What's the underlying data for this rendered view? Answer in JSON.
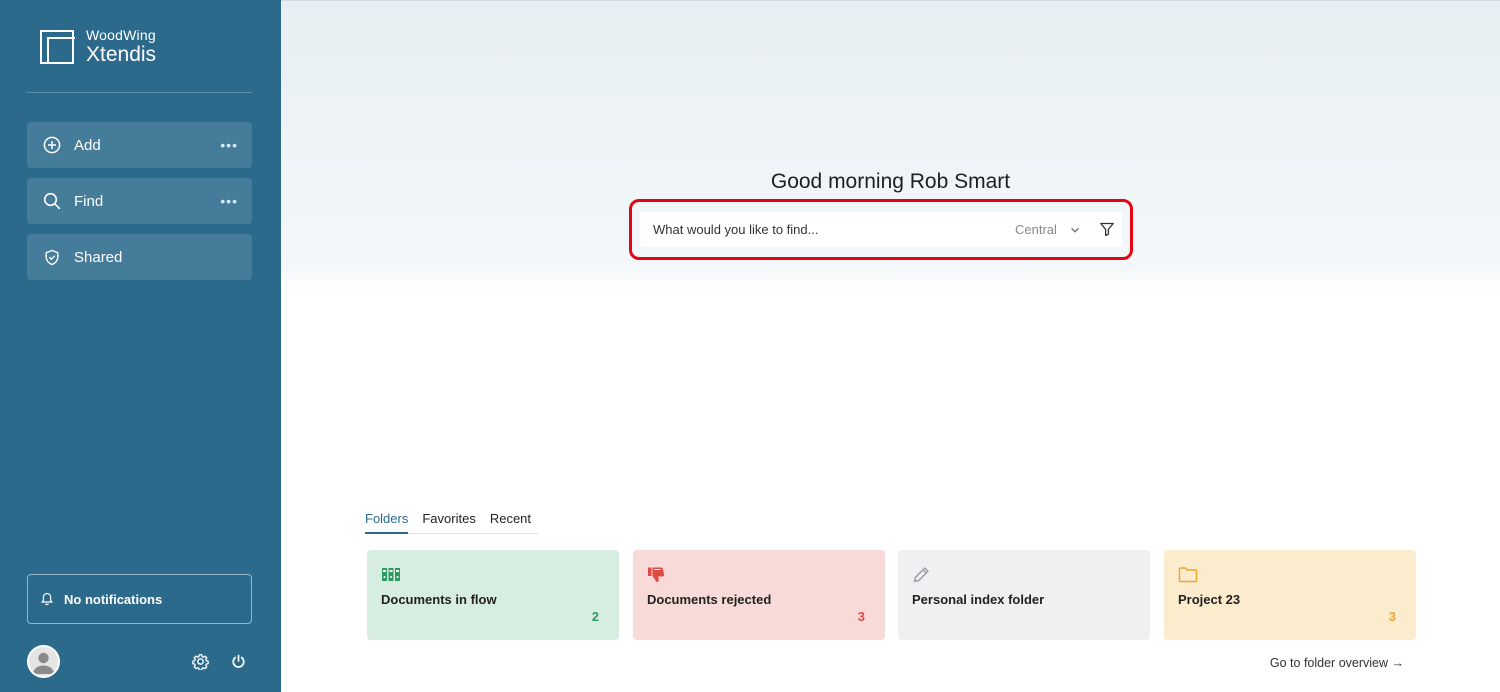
{
  "brand": {
    "line1": "WoodWing",
    "line2": "Xtendis"
  },
  "sidebar": {
    "items": [
      {
        "label": "Add",
        "icon": "plus-circle-icon",
        "more": "•••"
      },
      {
        "label": "Find",
        "icon": "search-icon",
        "more": "•••"
      },
      {
        "label": "Shared",
        "icon": "shield-icon"
      }
    ],
    "notifications": "No notifications"
  },
  "main": {
    "greeting": "Good morning Rob Smart",
    "search": {
      "placeholder": "What would you like to find...",
      "scope": "Central"
    },
    "tabs": [
      "Folders",
      "Favorites",
      "Recent"
    ],
    "active_tab": "Folders",
    "cards": [
      {
        "title": "Documents in flow",
        "count": "2",
        "icon": "binders-icon",
        "bg": "#d7ede1",
        "accent": "#2e9b62"
      },
      {
        "title": "Documents rejected",
        "count": "3",
        "icon": "thumbs-down-icon",
        "bg": "#f8dad9",
        "accent": "#e04a44"
      },
      {
        "title": "Personal index folder",
        "count": "",
        "icon": "pencil-icon",
        "bg": "#eef0f2",
        "accent": "#9aa0a6"
      },
      {
        "title": "Project 23",
        "count": "3",
        "icon": "folder-icon",
        "bg": "#fcecce",
        "accent": "#f0a531"
      }
    ],
    "folder_overview_link": "Go to folder overview →"
  },
  "colors": {
    "sidebar": "#2c6a8c",
    "highlight": "#e20613",
    "accent": "#2c6a8c"
  }
}
